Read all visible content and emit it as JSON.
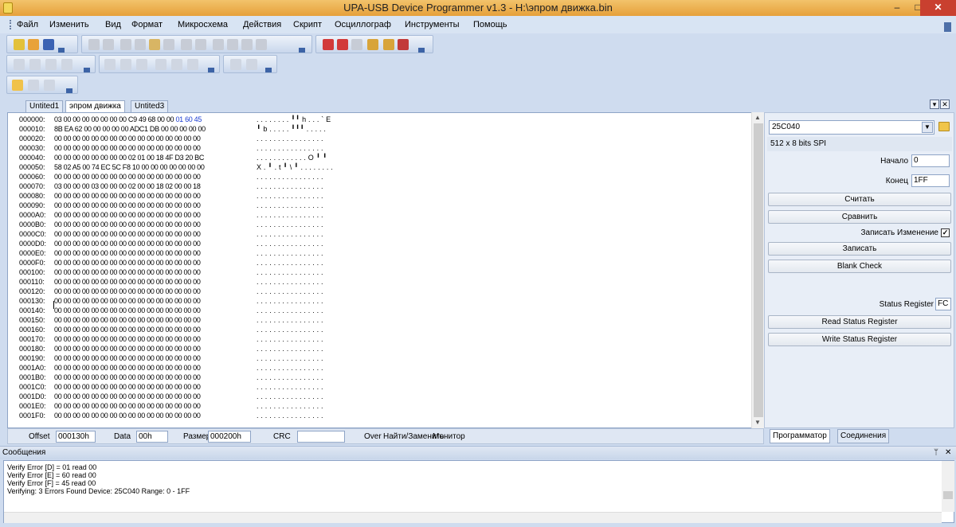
{
  "window": {
    "title": "UPA-USB Device Programmer v1.3 - H:\\эпром движка.bin",
    "minimize": "–",
    "maximize": "□",
    "close": "✕"
  },
  "menu": [
    "Файл",
    "Изменить",
    "Вид",
    "Формат",
    "Микросхема",
    "Действия",
    "Скрипт",
    "Осциллограф",
    "Инструменты",
    "Помощь"
  ],
  "tabs": [
    "Untited1",
    "эпром движка",
    "Untited3"
  ],
  "active_tab": 1,
  "hex_rows": [
    {
      "off": "000000:",
      "hex": "03 00 00 00 00 00 00 00 C9 49 68 00 00 ",
      "hexhl": "01 60 45",
      "asc": ". . . . . . . . ╹╹ h . . . ` E"
    },
    {
      "off": "000010:",
      "hex": "8B EA 62 00 00 00 00 00 ADC1 DB 00 00 00 00 00",
      "hexhl": "",
      "asc": "╹ b . . . . . ╹╹╹ . . . . ."
    },
    {
      "off": "000020:",
      "hex": "00 00 00 00 00 00 00 00 00 00 00 00 00 00 00 00",
      "hexhl": "",
      "asc": ". . . . . . . . . . . . . . . ."
    },
    {
      "off": "000030:",
      "hex": "00 00 00 00 00 00 00 00 00 00 00 00 00 00 00 00",
      "hexhl": "",
      "asc": ". . . . . . . . . . . . . . . ."
    },
    {
      "off": "000040:",
      "hex": "00 00 00 00 00 00 00 00 02 01 00 18 4F D3 20 BC",
      "hexhl": "",
      "asc": ". . . . . . . . . . . . O ╹  ╹"
    },
    {
      "off": "000050:",
      "hex": "58 02 A5 00 74 EC 5C F8 10 00 00 00 00 00 00 00",
      "hexhl": "",
      "asc": "X . ╹ . t ╹ \\ ╹ . . . . . . . ."
    },
    {
      "off": "000060:",
      "hex": "00 00 00 00 00 00 00 00 00 00 00 00 00 00 00 00",
      "hexhl": "",
      "asc": ". . . . . . . . . . . . . . . ."
    },
    {
      "off": "000070:",
      "hex": "03 00 00 00 03 00 00 00 02 00 00 18 02 00 00 18",
      "hexhl": "",
      "asc": ". . . . . . . . . . . . . . . ."
    },
    {
      "off": "000080:",
      "hex": "00 00 00 00 00 00 00 00 00 00 00 00 00 00 00 00",
      "hexhl": "",
      "asc": ". . . . . . . . . . . . . . . ."
    },
    {
      "off": "000090:",
      "hex": "00 00 00 00 00 00 00 00 00 00 00 00 00 00 00 00",
      "hexhl": "",
      "asc": ". . . . . . . . . . . . . . . ."
    },
    {
      "off": "0000A0:",
      "hex": "00 00 00 00 00 00 00 00 00 00 00 00 00 00 00 00",
      "hexhl": "",
      "asc": ". . . . . . . . . . . . . . . ."
    },
    {
      "off": "0000B0:",
      "hex": "00 00 00 00 00 00 00 00 00 00 00 00 00 00 00 00",
      "hexhl": "",
      "asc": ". . . . . . . . . . . . . . . ."
    },
    {
      "off": "0000C0:",
      "hex": "00 00 00 00 00 00 00 00 00 00 00 00 00 00 00 00",
      "hexhl": "",
      "asc": ". . . . . . . . . . . . . . . ."
    },
    {
      "off": "0000D0:",
      "hex": "00 00 00 00 00 00 00 00 00 00 00 00 00 00 00 00",
      "hexhl": "",
      "asc": ". . . . . . . . . . . . . . . ."
    },
    {
      "off": "0000E0:",
      "hex": "00 00 00 00 00 00 00 00 00 00 00 00 00 00 00 00",
      "hexhl": "",
      "asc": ". . . . . . . . . . . . . . . ."
    },
    {
      "off": "0000F0:",
      "hex": "00 00 00 00 00 00 00 00 00 00 00 00 00 00 00 00",
      "hexhl": "",
      "asc": ". . . . . . . . . . . . . . . ."
    },
    {
      "off": "000100:",
      "hex": "00 00 00 00 00 00 00 00 00 00 00 00 00 00 00 00",
      "hexhl": "",
      "asc": ". . . . . . . . . . . . . . . ."
    },
    {
      "off": "000110:",
      "hex": "00 00 00 00 00 00 00 00 00 00 00 00 00 00 00 00",
      "hexhl": "",
      "asc": ". . . . . . . . . . . . . . . ."
    },
    {
      "off": "000120:",
      "hex": "00 00 00 00 00 00 00 00 00 00 00 00 00 00 00 00",
      "hexhl": "",
      "asc": ". . . . . . . . . . . . . . . ."
    },
    {
      "off": "000130:",
      "hex": "00 00 00 00 00 00 00 00 00 00 00 00 00 00 00 00",
      "hexhl": "",
      "asc": ". . . . . . . . . . . . . . . ."
    },
    {
      "off": "000140:",
      "hex": "00 00 00 00 00 00 00 00 00 00 00 00 00 00 00 00",
      "hexhl": "",
      "asc": ". . . . . . . . . . . . . . . ."
    },
    {
      "off": "000150:",
      "hex": "00 00 00 00 00 00 00 00 00 00 00 00 00 00 00 00",
      "hexhl": "",
      "asc": ". . . . . . . . . . . . . . . ."
    },
    {
      "off": "000160:",
      "hex": "00 00 00 00 00 00 00 00 00 00 00 00 00 00 00 00",
      "hexhl": "",
      "asc": ". . . . . . . . . . . . . . . ."
    },
    {
      "off": "000170:",
      "hex": "00 00 00 00 00 00 00 00 00 00 00 00 00 00 00 00",
      "hexhl": "",
      "asc": ". . . . . . . . . . . . . . . ."
    },
    {
      "off": "000180:",
      "hex": "00 00 00 00 00 00 00 00 00 00 00 00 00 00 00 00",
      "hexhl": "",
      "asc": ". . . . . . . . . . . . . . . ."
    },
    {
      "off": "000190:",
      "hex": "00 00 00 00 00 00 00 00 00 00 00 00 00 00 00 00",
      "hexhl": "",
      "asc": ". . . . . . . . . . . . . . . ."
    },
    {
      "off": "0001A0:",
      "hex": "00 00 00 00 00 00 00 00 00 00 00 00 00 00 00 00",
      "hexhl": "",
      "asc": ". . . . . . . . . . . . . . . ."
    },
    {
      "off": "0001B0:",
      "hex": "00 00 00 00 00 00 00 00 00 00 00 00 00 00 00 00",
      "hexhl": "",
      "asc": ". . . . . . . . . . . . . . . ."
    },
    {
      "off": "0001C0:",
      "hex": "00 00 00 00 00 00 00 00 00 00 00 00 00 00 00 00",
      "hexhl": "",
      "asc": ". . . . . . . . . . . . . . . ."
    },
    {
      "off": "0001D0:",
      "hex": "00 00 00 00 00 00 00 00 00 00 00 00 00 00 00 00",
      "hexhl": "",
      "asc": ". . . . . . . . . . . . . . . ."
    },
    {
      "off": "0001E0:",
      "hex": "00 00 00 00 00 00 00 00 00 00 00 00 00 00 00 00",
      "hexhl": "",
      "asc": ". . . . . . . . . . . . . . . ."
    },
    {
      "off": "0001F0:",
      "hex": "00 00 00 00 00 00 00 00 00 00 00 00 00 00 00 00",
      "hexhl": "",
      "asc": ". . . . . . . . . . . . . . . ."
    }
  ],
  "status": {
    "offset_label": "Offset",
    "offset_value": "000130h",
    "data_label": "Data",
    "data_value": "00h",
    "size_label": "Размер",
    "size_value": "000200h",
    "crc_label": "CRC",
    "crc_value": "",
    "over_label": "Over",
    "find_label": "Найти/Заменить",
    "monitor_label": "Монитор"
  },
  "panel": {
    "chip": "25C040",
    "chip_info": "512 x 8 bits SPI",
    "start_label": "Начало",
    "start_value": "0",
    "end_label": "Конец",
    "end_value": "1FF",
    "read_button": "Считать",
    "compare_button": "Сравнить",
    "write_changes_label": "Записать Изменение",
    "write_changes_checked": "✓",
    "write_button": "Записать",
    "blank_button": "Blank Check",
    "status_reg_label": "Status Register",
    "status_reg_value": "FC",
    "read_status_button": "Read Status Register",
    "write_status_button": "Write Status Register",
    "tabs": [
      "Программатор",
      "Соединения"
    ]
  },
  "messages": {
    "title": "Сообщения",
    "pin": "📌",
    "close": "✕",
    "lines": [
      "Verify Error [D] = 01 read 00",
      "Verify Error [E] = 60 read 00",
      "Verify Error [F] = 45 read 00",
      "Verifying:  3 Errors Found   Device: 25C040 Range: 0 - 1FF"
    ]
  }
}
